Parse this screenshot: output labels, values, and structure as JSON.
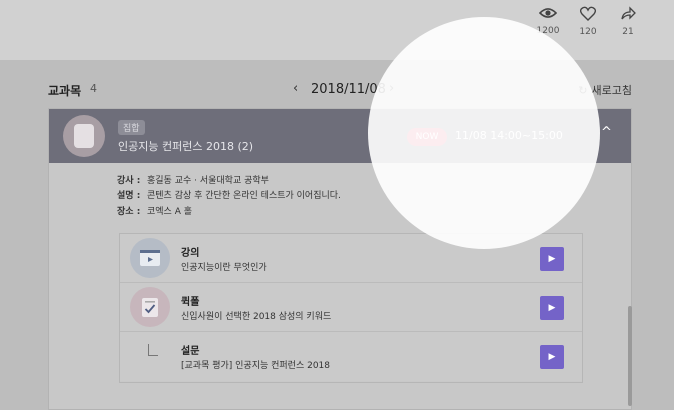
{
  "stats": [
    {
      "icon": "eye-icon",
      "value": "1200"
    },
    {
      "icon": "heart-icon",
      "value": "120"
    },
    {
      "icon": "share-icon",
      "value": "21"
    }
  ],
  "list": {
    "title": "교과목",
    "count": "4",
    "date": "2018/11/08",
    "prev": "‹",
    "next": "›",
    "refresh": "새로고침"
  },
  "course": {
    "badge": "집합",
    "title": "인공지능 컨퍼런스 2018 (2)",
    "status": "NOW",
    "time": "11/08  14:00~15:00",
    "collapse": "^"
  },
  "details": [
    {
      "key": "강사 :",
      "value": "홍길동  교수 · 서울대학교 공학부"
    },
    {
      "key": "설명 :",
      "value": "콘텐츠 감상 후 간단한 온라인 테스트가 이어집니다."
    },
    {
      "key": "장소 :",
      "value": "코엑스 A 홀"
    }
  ],
  "items": [
    {
      "title": "강의",
      "desc": "인공지능이란 무엇인가",
      "icon": "video-icon"
    },
    {
      "title": "퀵폴",
      "desc": "신입사원이 선택한 2018 삼성의 키워드",
      "icon": "poll-icon"
    },
    {
      "title": "설문",
      "desc": "[교과목 평가] 인공지능 컨퍼런스 2018",
      "icon": "survey-icon"
    }
  ],
  "colors": {
    "accent": "#7463c8",
    "now": "#e2476a",
    "header": "#6e6e7a"
  }
}
